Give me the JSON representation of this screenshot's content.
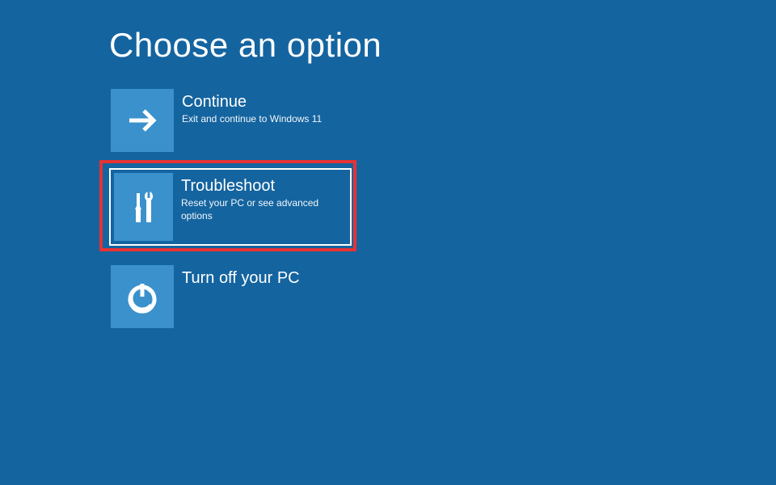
{
  "title": "Choose an option",
  "options": [
    {
      "id": "continue",
      "title": "Continue",
      "subtitle": "Exit and continue to Windows 11",
      "icon": "arrow-right-icon",
      "selected": false,
      "highlighted": false
    },
    {
      "id": "troubleshoot",
      "title": "Troubleshoot",
      "subtitle": "Reset your PC or see advanced options",
      "icon": "tools-icon",
      "selected": true,
      "highlighted": true
    },
    {
      "id": "turnoff",
      "title": "Turn off your PC",
      "subtitle": "",
      "icon": "power-icon",
      "selected": false,
      "highlighted": false
    }
  ],
  "colors": {
    "background": "#1464a0",
    "tile": "#3a91cc",
    "highlight": "#e63333",
    "text": "#ffffff"
  }
}
